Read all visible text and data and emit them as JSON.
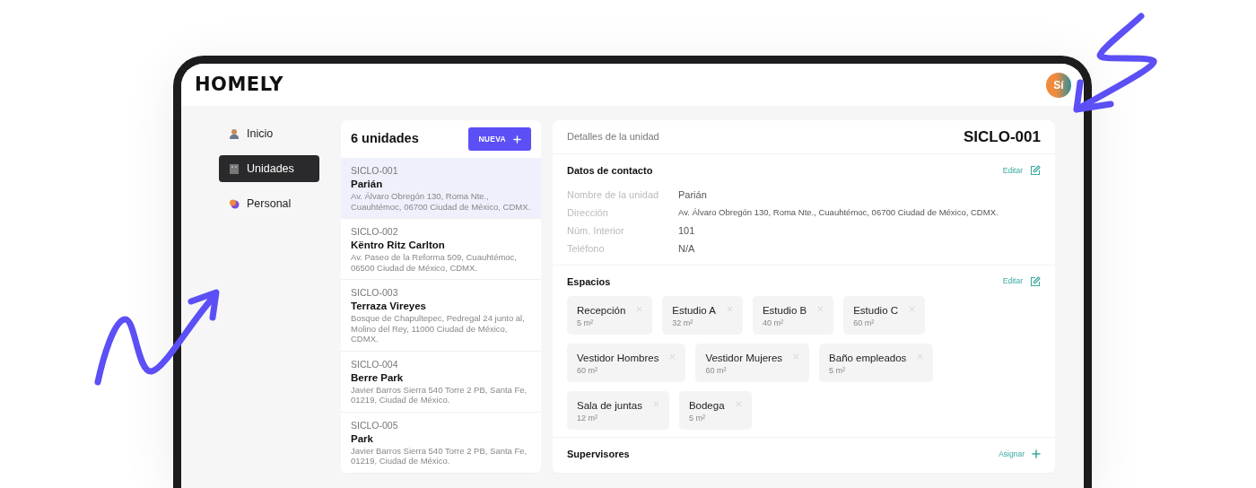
{
  "brand": "HOMELY",
  "user": {
    "initials": "Sí"
  },
  "sidebar": {
    "items": [
      {
        "label": "Inicio",
        "selected": false
      },
      {
        "label": "Unidades",
        "selected": true
      },
      {
        "label": "Personal",
        "selected": false
      }
    ]
  },
  "units": {
    "count_label": "6 unidades",
    "new_button": "NUEVA",
    "items": [
      {
        "code": "SICLO-001",
        "name": "Parián",
        "address": "Av. Álvaro Obregón 130, Roma Nte., Cuauhtémoc, 06700 Ciudad de México, CDMX.",
        "selected": true
      },
      {
        "code": "SICLO-002",
        "name": "Këntro Ritz Carlton",
        "address": "Av. Paseo de la Reforma 509, Cuauhtémoc, 06500 Ciudad de México, CDMX.",
        "selected": false
      },
      {
        "code": "SICLO-003",
        "name": "Terraza Vireyes",
        "address": "Bosque de Chapultepec, Pedregal 24 junto al, Molino del Rey, 11000 Ciudad de México, CDMX.",
        "selected": false
      },
      {
        "code": "SICLO-004",
        "name": "Berre Park",
        "address": "Javier Barros Sierra 540 Torre 2 PB, Santa Fe, 01219, Ciudad de México.",
        "selected": false
      },
      {
        "code": "SICLO-005",
        "name": "Park",
        "address": "Javier Barros Sierra 540 Torre 2 PB, Santa Fe, 01219, Ciudad de México.",
        "selected": false
      }
    ]
  },
  "details": {
    "title": "Detalles de la unidad",
    "code": "SICLO-001",
    "contact": {
      "heading": "Datos de contacto",
      "edit_label": "Editar",
      "fields": [
        {
          "label": "Nombre de la unidad",
          "value": "Parián"
        },
        {
          "label": "Dirección",
          "value": "Av. Álvaro Obregón 130, Roma Nte., Cuauhtémoc, 06700 Ciudad de México, CDMX."
        },
        {
          "label": "Núm. Interior",
          "value": "101"
        },
        {
          "label": "Teléfono",
          "value": "N/A"
        }
      ]
    },
    "spaces": {
      "heading": "Espacios",
      "edit_label": "Editar",
      "items": [
        {
          "name": "Recepción",
          "area": "5 m²"
        },
        {
          "name": "Estudio A",
          "area": "32 m²"
        },
        {
          "name": "Estudio B",
          "area": "40 m²"
        },
        {
          "name": "Estudio C",
          "area": "60 m²"
        },
        {
          "name": "Vestidor Hombres",
          "area": "60 m²"
        },
        {
          "name": "Vestidor Mujeres",
          "area": "60 m²"
        },
        {
          "name": "Baño empleados",
          "area": "5 m²"
        },
        {
          "name": "Sala de juntas",
          "area": "12 m²"
        },
        {
          "name": "Bodega",
          "area": "5 m²"
        }
      ]
    },
    "supervisors": {
      "heading": "Supervisores",
      "action_label": "Asignar"
    }
  }
}
